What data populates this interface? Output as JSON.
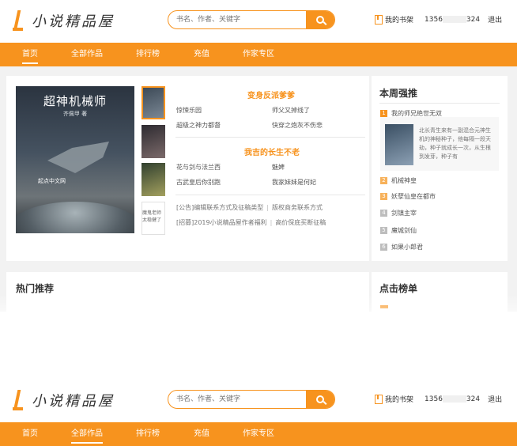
{
  "header": {
    "logo_text": "小说精品屋",
    "search_placeholder": "书名、作者、关键字",
    "bookshelf_label": "我的书架",
    "phone_prefix": "1356",
    "phone_suffix": "324",
    "logout_label": "退出"
  },
  "nav": {
    "items": [
      "首页",
      "全部作品",
      "排行榜",
      "充值",
      "作家专区"
    ]
  },
  "featured": {
    "cover_title": "超神机械师",
    "cover_author": "齐佩甲 著",
    "cover_brand": "起点中文网",
    "thumb4_text": "魔鬼老师\n太稳健了",
    "group1_title": "变身反派爹爹",
    "group1_links": [
      "惊悚乐园",
      "师父又掉线了",
      "超级之神力都督",
      "快穿之炮灰不伤悲"
    ],
    "group2_title": "我吉的长生不老",
    "group2_links": [
      "花与剑与法兰西",
      "魅婢",
      "古武皇后你别跑",
      "我家妹妹是何妃"
    ],
    "notices": [
      {
        "tag": "[公告]",
        "text": "编辑联系方式及征稿类型",
        "extra": "版权商务联系方式"
      },
      {
        "tag": "[招募]",
        "text": "2019小说精品屋作者福利",
        "extra": "高价保底买断征稿"
      }
    ]
  },
  "weekly": {
    "title": "本周强推",
    "items": [
      {
        "rank": "1",
        "name": "我的师兄绝世无双"
      },
      {
        "rank": "2",
        "name": "机械神皇"
      },
      {
        "rank": "3",
        "name": "妖孽仙皇在都市"
      },
      {
        "rank": "4",
        "name": "剑镇主宰"
      },
      {
        "rank": "5",
        "name": "魔城剑仙"
      },
      {
        "rank": "6",
        "name": "如果小郎君"
      }
    ],
    "top_desc": "北长青生来有一副混合元神生机的神秘种子，他每隔一段天劫，种子就成长一次，从生根到发芽，种子有"
  },
  "sections": {
    "hot_title": "热门推荐",
    "click_title": "点击榜单"
  }
}
